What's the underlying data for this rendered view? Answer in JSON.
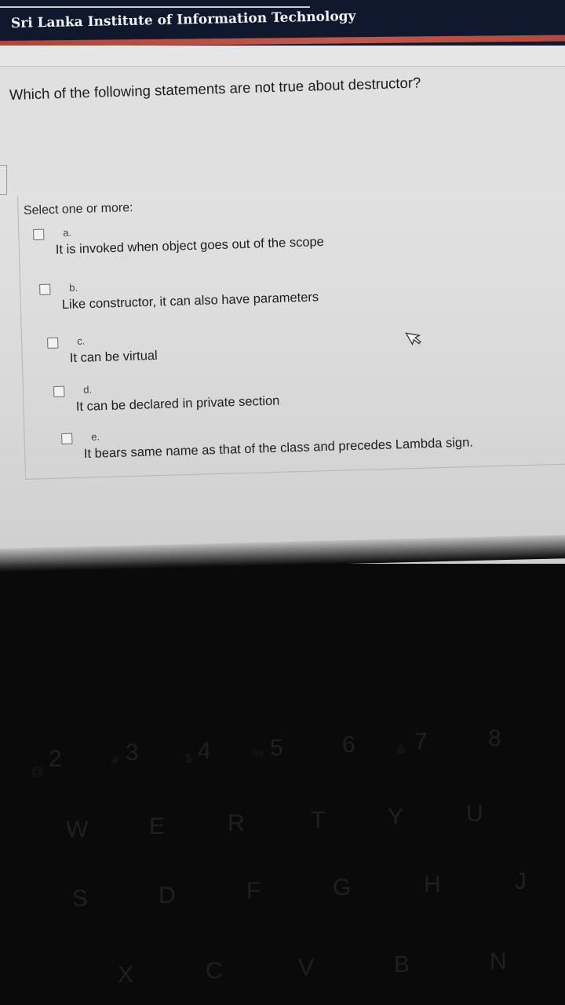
{
  "header": {
    "site_name": "Sri Lanka Institute of Information Technology"
  },
  "question": {
    "text": "Which of the following statements are not true about destructor?",
    "select_prompt": "Select one or more:"
  },
  "options": [
    {
      "letter": "a.",
      "text": "It is invoked when object goes out of the scope",
      "checked": false
    },
    {
      "letter": "b.",
      "text": "Like constructor, it can also have parameters",
      "checked": false
    },
    {
      "letter": "c.",
      "text": "It can be virtual",
      "checked": false
    },
    {
      "letter": "d.",
      "text": "It can be declared in private section",
      "checked": false
    },
    {
      "letter": "e.",
      "text": "It bears same name as that of the class and precedes Lambda sign.",
      "checked": false
    }
  ],
  "cursor": {
    "icon": "mouse-pointer-icon"
  },
  "keyboard": {
    "number_row": [
      "@",
      "2",
      "#",
      "3",
      "$",
      "4",
      "%",
      "5",
      "6",
      "&",
      "7",
      "8"
    ],
    "top_row": [
      "W",
      "E",
      "R",
      "T",
      "Y",
      "U"
    ],
    "home_row": [
      "S",
      "D",
      "F",
      "G",
      "H",
      "J"
    ],
    "bottom_row": [
      "X",
      "C",
      "V",
      "B",
      "N"
    ]
  },
  "colors": {
    "header_bg": "#10182e",
    "accent": "#b5433a",
    "screen_bg": "#e0e0e0",
    "keyboard_bg": "#0a0a0b"
  }
}
